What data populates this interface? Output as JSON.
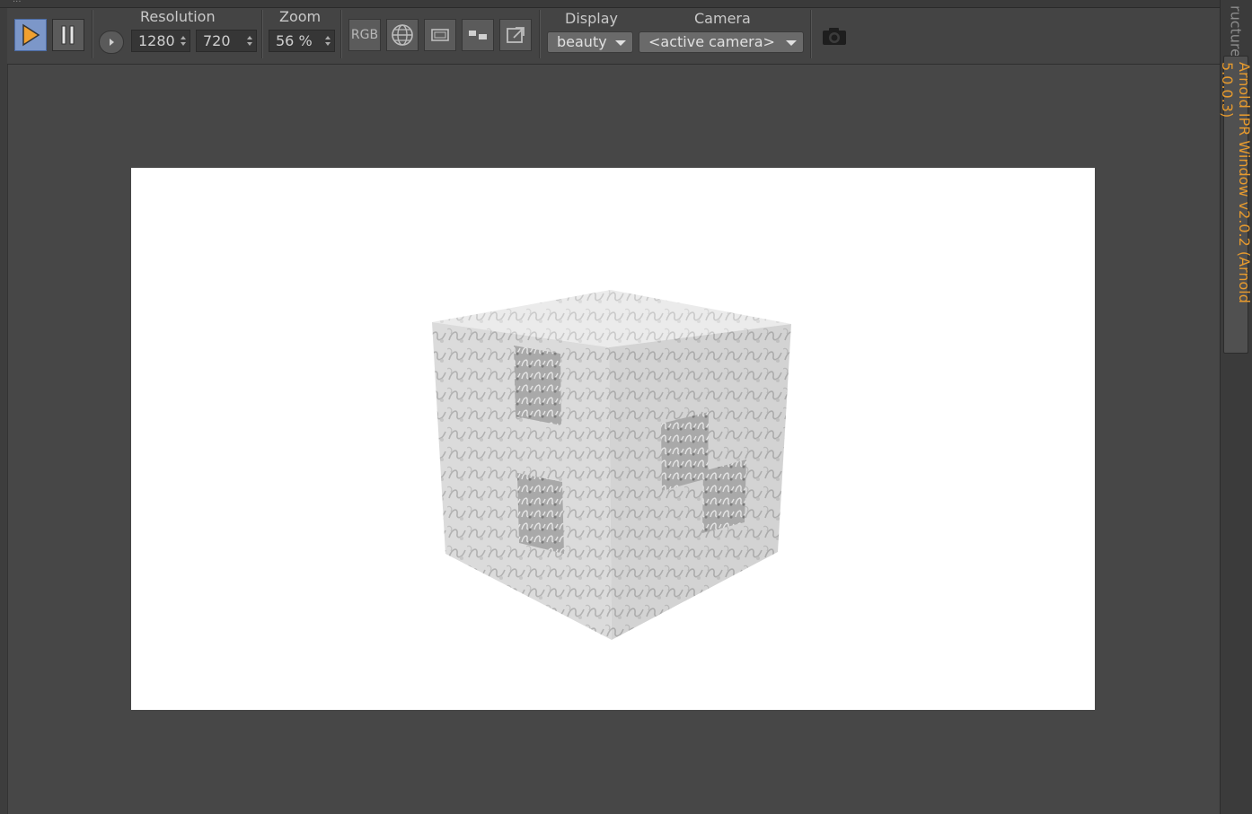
{
  "window": {
    "menu_dots": "..."
  },
  "toolbar": {
    "resolution_label": "Resolution",
    "resolution_width": "1280",
    "resolution_height": "720",
    "zoom_label": "Zoom",
    "zoom_value": "56 %",
    "rgb_label": "RGB",
    "display_label": "Display",
    "display_value": "beauty",
    "camera_label": "Camera",
    "camera_value": "<active camera>"
  },
  "side_tabs": {
    "inactive_tab": "ructure",
    "active_tab": "Arnold IPR Window v2.0.2 (Arnold 5.0.0.3)"
  },
  "colors": {
    "play_active_bg": "#7c97c9",
    "play_icon": "#f0a030",
    "active_tab_text": "#e69a2e",
    "render_bg": "#ffffff"
  }
}
